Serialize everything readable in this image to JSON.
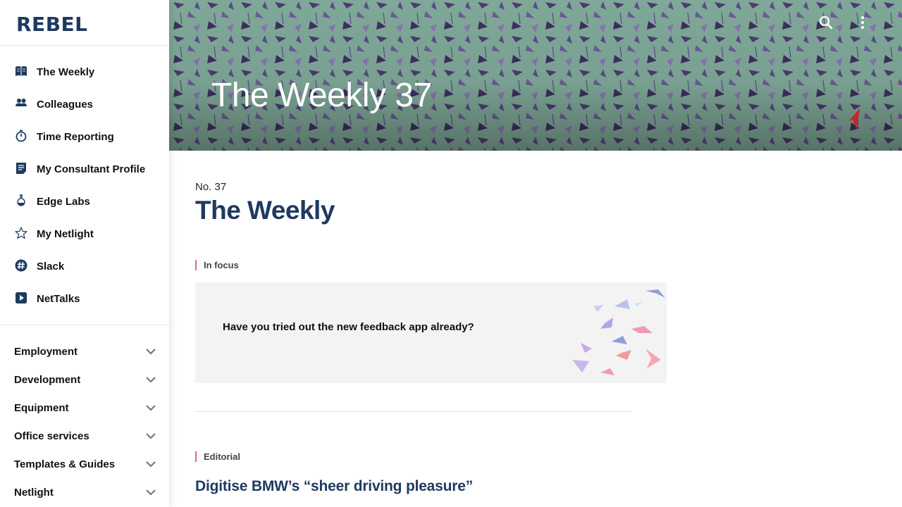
{
  "sidebar": {
    "logo": "REBEL",
    "nav": [
      {
        "label": "The Weekly",
        "icon": "book-icon"
      },
      {
        "label": "Colleagues",
        "icon": "people-icon"
      },
      {
        "label": "Time Reporting",
        "icon": "timer-icon"
      },
      {
        "label": "My Consultant Profile",
        "icon": "document-icon"
      },
      {
        "label": "Edge Labs",
        "icon": "flask-icon"
      },
      {
        "label": "My Netlight",
        "icon": "star-icon"
      },
      {
        "label": "Slack",
        "icon": "slack-icon"
      },
      {
        "label": "NetTalks",
        "icon": "play-icon"
      }
    ],
    "sections": [
      {
        "label": "Employment"
      },
      {
        "label": "Development"
      },
      {
        "label": "Equipment"
      },
      {
        "label": "Office services"
      },
      {
        "label": "Templates & Guides"
      },
      {
        "label": "Netlight"
      }
    ]
  },
  "hero": {
    "title": "The Weekly 37",
    "background_color": "#7fa898"
  },
  "main": {
    "issue_number": "No. 37",
    "title": "The Weekly",
    "in_focus_label": "In focus",
    "focus_card_text": "Have you tried out the new feedback app already?",
    "editorial_label": "Editorial",
    "editorial_title": "Digitise BMW’s “sheer driving pleasure”"
  },
  "colors": {
    "brand_navy": "#1f3a60",
    "tag_accent": "#e06c78",
    "card_bg": "#f3f3f3"
  }
}
